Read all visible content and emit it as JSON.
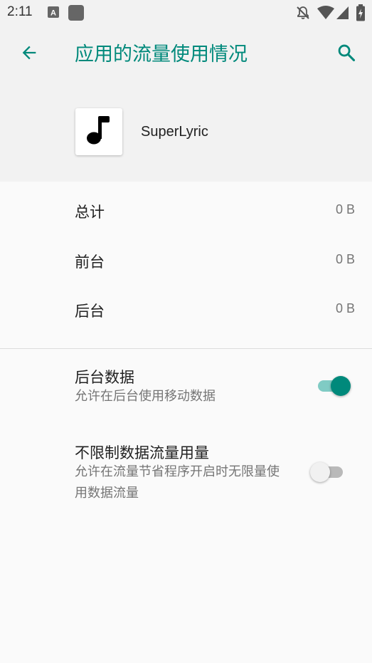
{
  "status_bar": {
    "time": "2:11"
  },
  "header": {
    "title": "应用的流量使用情况",
    "back_icon": "arrow-left-icon",
    "search_icon": "search-icon"
  },
  "app": {
    "name": "SuperLyric",
    "icon": "music-note-icon"
  },
  "usage": [
    {
      "label": "总计",
      "value": "0 B"
    },
    {
      "label": "前台",
      "value": "0 B"
    },
    {
      "label": "后台",
      "value": "0 B"
    }
  ],
  "settings": {
    "background_data": {
      "title": "后台数据",
      "summary": "允许在后台使用移动数据",
      "enabled": true
    },
    "unrestricted_data": {
      "title": "不限制数据流量用量",
      "summary": "允许在流量节省程序开启时无限量使用数据流量",
      "enabled": false
    }
  },
  "colors": {
    "accent": "#00897b",
    "accent_track": "#80cbc4",
    "off_thumb": "#f1f1f1",
    "off_track": "#b9b9b9"
  }
}
